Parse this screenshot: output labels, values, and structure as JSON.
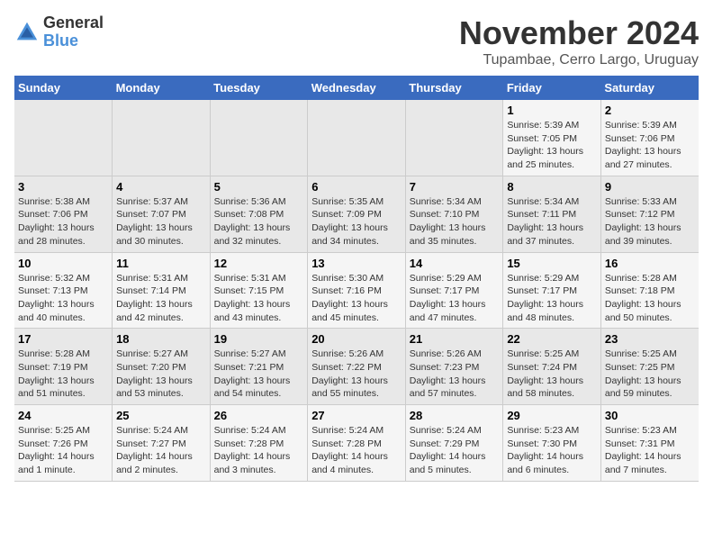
{
  "logo": {
    "text_general": "General",
    "text_blue": "Blue"
  },
  "title": "November 2024",
  "subtitle": "Tupambae, Cerro Largo, Uruguay",
  "days_of_week": [
    "Sunday",
    "Monday",
    "Tuesday",
    "Wednesday",
    "Thursday",
    "Friday",
    "Saturday"
  ],
  "weeks": [
    [
      {
        "day": "",
        "info": ""
      },
      {
        "day": "",
        "info": ""
      },
      {
        "day": "",
        "info": ""
      },
      {
        "day": "",
        "info": ""
      },
      {
        "day": "",
        "info": ""
      },
      {
        "day": "1",
        "info": "Sunrise: 5:39 AM\nSunset: 7:05 PM\nDaylight: 13 hours\nand 25 minutes."
      },
      {
        "day": "2",
        "info": "Sunrise: 5:39 AM\nSunset: 7:06 PM\nDaylight: 13 hours\nand 27 minutes."
      }
    ],
    [
      {
        "day": "3",
        "info": "Sunrise: 5:38 AM\nSunset: 7:06 PM\nDaylight: 13 hours\nand 28 minutes."
      },
      {
        "day": "4",
        "info": "Sunrise: 5:37 AM\nSunset: 7:07 PM\nDaylight: 13 hours\nand 30 minutes."
      },
      {
        "day": "5",
        "info": "Sunrise: 5:36 AM\nSunset: 7:08 PM\nDaylight: 13 hours\nand 32 minutes."
      },
      {
        "day": "6",
        "info": "Sunrise: 5:35 AM\nSunset: 7:09 PM\nDaylight: 13 hours\nand 34 minutes."
      },
      {
        "day": "7",
        "info": "Sunrise: 5:34 AM\nSunset: 7:10 PM\nDaylight: 13 hours\nand 35 minutes."
      },
      {
        "day": "8",
        "info": "Sunrise: 5:34 AM\nSunset: 7:11 PM\nDaylight: 13 hours\nand 37 minutes."
      },
      {
        "day": "9",
        "info": "Sunrise: 5:33 AM\nSunset: 7:12 PM\nDaylight: 13 hours\nand 39 minutes."
      }
    ],
    [
      {
        "day": "10",
        "info": "Sunrise: 5:32 AM\nSunset: 7:13 PM\nDaylight: 13 hours\nand 40 minutes."
      },
      {
        "day": "11",
        "info": "Sunrise: 5:31 AM\nSunset: 7:14 PM\nDaylight: 13 hours\nand 42 minutes."
      },
      {
        "day": "12",
        "info": "Sunrise: 5:31 AM\nSunset: 7:15 PM\nDaylight: 13 hours\nand 43 minutes."
      },
      {
        "day": "13",
        "info": "Sunrise: 5:30 AM\nSunset: 7:16 PM\nDaylight: 13 hours\nand 45 minutes."
      },
      {
        "day": "14",
        "info": "Sunrise: 5:29 AM\nSunset: 7:17 PM\nDaylight: 13 hours\nand 47 minutes."
      },
      {
        "day": "15",
        "info": "Sunrise: 5:29 AM\nSunset: 7:17 PM\nDaylight: 13 hours\nand 48 minutes."
      },
      {
        "day": "16",
        "info": "Sunrise: 5:28 AM\nSunset: 7:18 PM\nDaylight: 13 hours\nand 50 minutes."
      }
    ],
    [
      {
        "day": "17",
        "info": "Sunrise: 5:28 AM\nSunset: 7:19 PM\nDaylight: 13 hours\nand 51 minutes."
      },
      {
        "day": "18",
        "info": "Sunrise: 5:27 AM\nSunset: 7:20 PM\nDaylight: 13 hours\nand 53 minutes."
      },
      {
        "day": "19",
        "info": "Sunrise: 5:27 AM\nSunset: 7:21 PM\nDaylight: 13 hours\nand 54 minutes."
      },
      {
        "day": "20",
        "info": "Sunrise: 5:26 AM\nSunset: 7:22 PM\nDaylight: 13 hours\nand 55 minutes."
      },
      {
        "day": "21",
        "info": "Sunrise: 5:26 AM\nSunset: 7:23 PM\nDaylight: 13 hours\nand 57 minutes."
      },
      {
        "day": "22",
        "info": "Sunrise: 5:25 AM\nSunset: 7:24 PM\nDaylight: 13 hours\nand 58 minutes."
      },
      {
        "day": "23",
        "info": "Sunrise: 5:25 AM\nSunset: 7:25 PM\nDaylight: 13 hours\nand 59 minutes."
      }
    ],
    [
      {
        "day": "24",
        "info": "Sunrise: 5:25 AM\nSunset: 7:26 PM\nDaylight: 14 hours\nand 1 minute."
      },
      {
        "day": "25",
        "info": "Sunrise: 5:24 AM\nSunset: 7:27 PM\nDaylight: 14 hours\nand 2 minutes."
      },
      {
        "day": "26",
        "info": "Sunrise: 5:24 AM\nSunset: 7:28 PM\nDaylight: 14 hours\nand 3 minutes."
      },
      {
        "day": "27",
        "info": "Sunrise: 5:24 AM\nSunset: 7:28 PM\nDaylight: 14 hours\nand 4 minutes."
      },
      {
        "day": "28",
        "info": "Sunrise: 5:24 AM\nSunset: 7:29 PM\nDaylight: 14 hours\nand 5 minutes."
      },
      {
        "day": "29",
        "info": "Sunrise: 5:23 AM\nSunset: 7:30 PM\nDaylight: 14 hours\nand 6 minutes."
      },
      {
        "day": "30",
        "info": "Sunrise: 5:23 AM\nSunset: 7:31 PM\nDaylight: 14 hours\nand 7 minutes."
      }
    ]
  ]
}
